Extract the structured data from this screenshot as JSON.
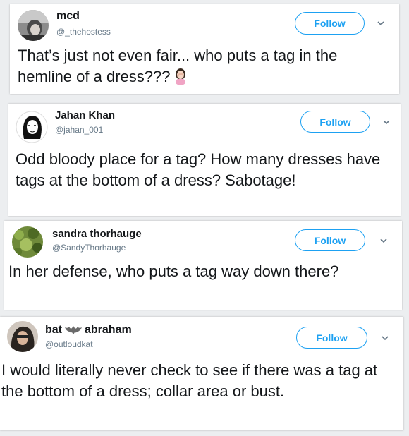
{
  "tweets": [
    {
      "name": "mcd",
      "handle": "@_thehostess",
      "follow_label": "Follow",
      "text": "That’s just not even fair... who puts a tag in the hemline of a dress???",
      "emoji": "person-facepalming-emoji"
    },
    {
      "name": "Jahan Khan",
      "handle": "@jahan_001",
      "follow_label": "Follow",
      "text": "Odd bloody place for a tag? How many dresses have tags at the bottom of a dress? Sabotage!"
    },
    {
      "name": "sandra thorhauge",
      "handle": "@SandyThorhauge",
      "follow_label": "Follow",
      "text": "In her defense, who puts a tag way down there?"
    },
    {
      "name_part1": "bat",
      "name_part2": "abraham",
      "name_icon": "bat-icon",
      "handle": "@outloudkat",
      "follow_label": "Follow",
      "text": "I would literally never check to see if there was a tag at the bottom of a dress; collar area or bust."
    }
  ],
  "colors": {
    "accent": "#1da1f2",
    "text": "#14171a",
    "muted": "#657786",
    "background": "#eceef0"
  }
}
